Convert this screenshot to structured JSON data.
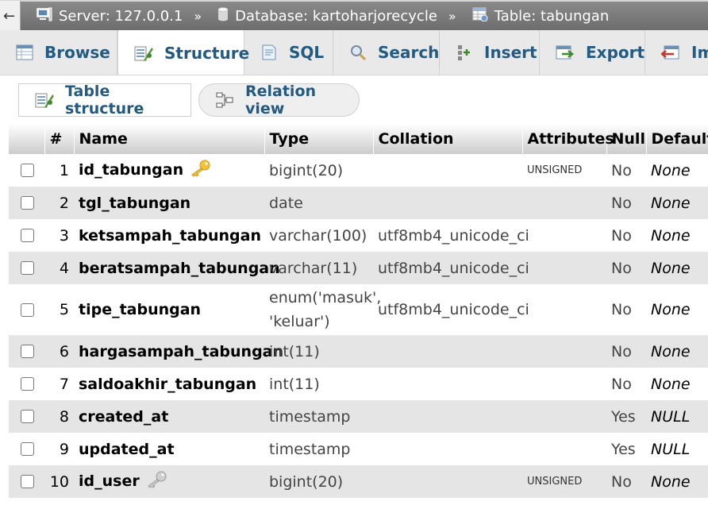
{
  "breadcrumb": {
    "back_glyph": "←",
    "server": "Server: 127.0.0.1",
    "database": "Database: kartoharjorecycle",
    "table": "Table: tabungan",
    "separator": "»"
  },
  "tabs": [
    {
      "label": "Browse",
      "icon": "browse-icon"
    },
    {
      "label": "Structure",
      "icon": "structure-icon",
      "active": true
    },
    {
      "label": "SQL",
      "icon": "sql-icon"
    },
    {
      "label": "Search",
      "icon": "search-icon"
    },
    {
      "label": "Insert",
      "icon": "insert-icon"
    },
    {
      "label": "Export",
      "icon": "export-icon"
    },
    {
      "label": "Im",
      "icon": "import-icon"
    }
  ],
  "subtabs": {
    "table_structure": "Table structure",
    "relation_view": "Relation view"
  },
  "columns": {
    "num": "#",
    "name": "Name",
    "type": "Type",
    "collation": "Collation",
    "attributes": "Attributes",
    "null": "Null",
    "default": "Default"
  },
  "rows": [
    {
      "num": "1",
      "name": "id_tabungan",
      "key": "primary",
      "type": "bigint(20)",
      "collation": "",
      "attributes": "UNSIGNED",
      "null": "No",
      "default": "None"
    },
    {
      "num": "2",
      "name": "tgl_tabungan",
      "type": "date",
      "collation": "",
      "attributes": "",
      "null": "No",
      "default": "None"
    },
    {
      "num": "3",
      "name": "ketsampah_tabungan",
      "type": "varchar(100)",
      "collation": "utf8mb4_unicode_ci",
      "attributes": "",
      "null": "No",
      "default": "None"
    },
    {
      "num": "4",
      "name": "beratsampah_tabungan",
      "type": "varchar(11)",
      "collation": "utf8mb4_unicode_ci",
      "attributes": "",
      "null": "No",
      "default": "None"
    },
    {
      "num": "5",
      "name": "tipe_tabungan",
      "type": "enum('masuk', 'keluar')",
      "collation": "utf8mb4_unicode_ci",
      "attributes": "",
      "null": "No",
      "default": "None",
      "tall": true
    },
    {
      "num": "6",
      "name": "hargasampah_tabungan",
      "type": "int(11)",
      "collation": "",
      "attributes": "",
      "null": "No",
      "default": "None"
    },
    {
      "num": "7",
      "name": "saldoakhir_tabungan",
      "type": "int(11)",
      "collation": "",
      "attributes": "",
      "null": "No",
      "default": "None"
    },
    {
      "num": "8",
      "name": "created_at",
      "type": "timestamp",
      "collation": "",
      "attributes": "",
      "null": "Yes",
      "default": "NULL"
    },
    {
      "num": "9",
      "name": "updated_at",
      "type": "timestamp",
      "collation": "",
      "attributes": "",
      "null": "Yes",
      "default": "NULL"
    },
    {
      "num": "10",
      "name": "id_user",
      "key": "foreign",
      "type": "bigint(20)",
      "collation": "",
      "attributes": "UNSIGNED",
      "null": "No",
      "default": "None"
    }
  ],
  "colors": {
    "link": "#235a81",
    "topbar": "#6d6d6d",
    "row_alt": "#e5e5e5",
    "primary_key": "#f2c23a",
    "foreign_key": "#b5b5b5"
  }
}
